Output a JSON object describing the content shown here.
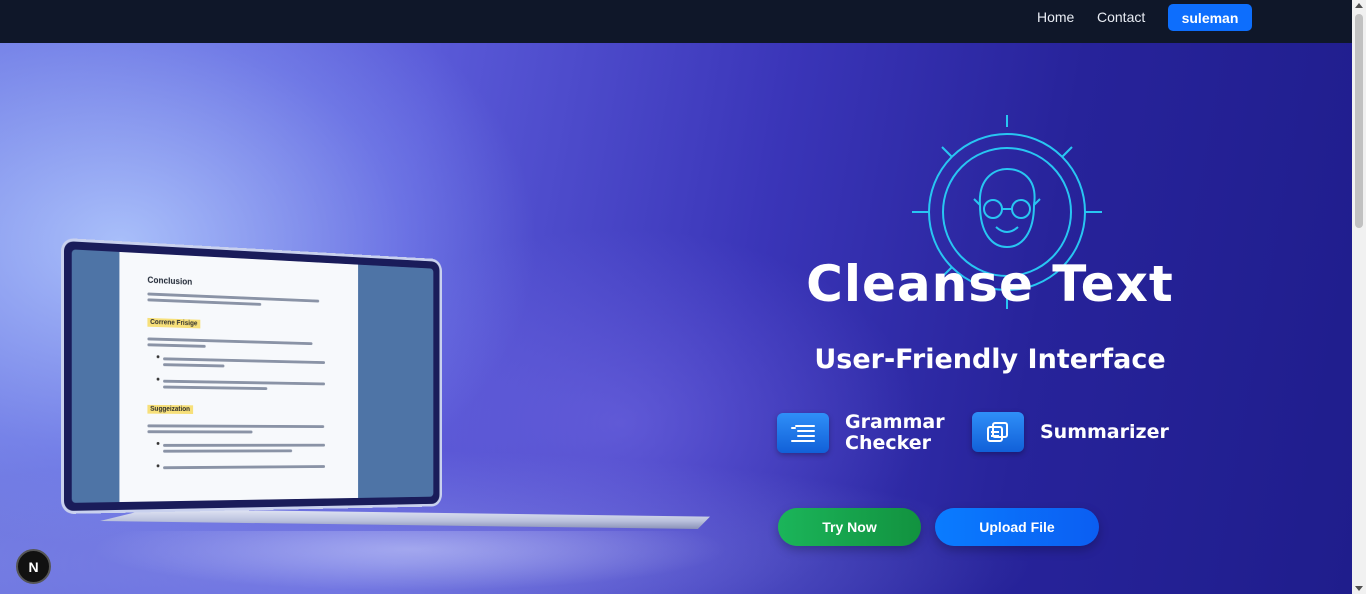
{
  "nav": {
    "home": "Home",
    "contact": "Contact",
    "user": "suleman"
  },
  "hero": {
    "title": "Cleanse Text",
    "subtitle": "User-Friendly Interface",
    "features": [
      {
        "label_line1": "Grammar",
        "label_line2": "Checker",
        "icon": "list-lines-icon"
      },
      {
        "label_line1": "Summarizer",
        "label_line2": "",
        "icon": "copy-pages-icon"
      }
    ],
    "try_button": "Try Now",
    "upload_button": "Upload File",
    "logo_icon": "smiling-face-with-glasses-icon"
  },
  "laptop_document": {
    "heading": "Conclusion",
    "highlight_1": "Correne Frisige",
    "highlight_2": "Suggeization"
  },
  "next_badge": "N",
  "colors": {
    "nav_bg": "#0f1729",
    "primary_blue": "#0d6efd",
    "try_green": "#1bb55a",
    "upload_blue": "#0a7cff",
    "icon_cyan": "#28c6f2"
  }
}
